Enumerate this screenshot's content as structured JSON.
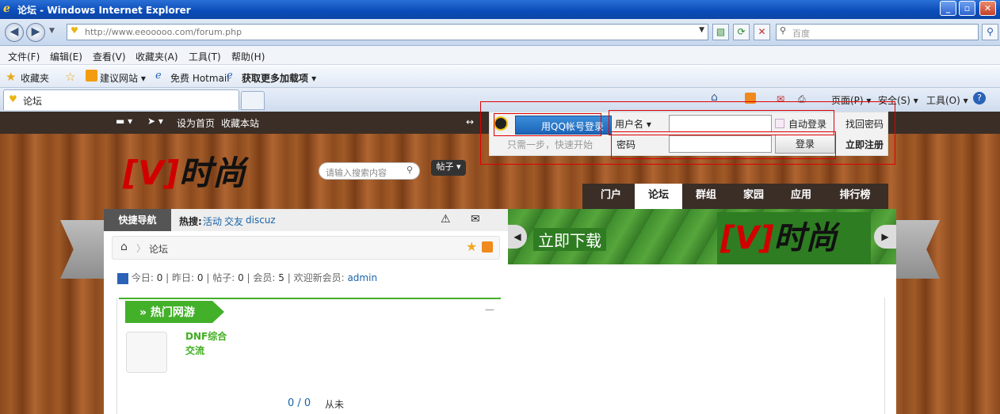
{
  "window": {
    "title": "论坛 - Windows Internet Explorer"
  },
  "address": {
    "url": "http://www.eeooooo.com/forum.php",
    "search_placeholder": "百度"
  },
  "menu": [
    "文件(F)",
    "编辑(E)",
    "查看(V)",
    "收藏夹(A)",
    "工具(T)",
    "帮助(H)"
  ],
  "favorites": {
    "label": "收藏夹",
    "items": [
      "建议网站 ▾",
      "免费 Hotmail",
      "获取更多加载项 ▾"
    ]
  },
  "tab": {
    "label": "论坛"
  },
  "commands": [
    "页面(P) ▾",
    "安全(S) ▾",
    "工具(O) ▾"
  ],
  "topbar": {
    "set_home": "设为首页",
    "bookmark": "收藏本站"
  },
  "login": {
    "qq_button": "用QQ帐号登录",
    "qq_hint": "只需一步，快速开始",
    "username_label": "用户名 ▾",
    "password_label": "密码",
    "auto_login": "自动登录",
    "login_button": "登录",
    "find_password": "找回密码",
    "register": "立即注册"
  },
  "logo": {
    "text": "时尚",
    "v": "[V]"
  },
  "site_search": {
    "placeholder": "请输入搜索内容",
    "type": "帖子 ▾"
  },
  "nav": [
    "门户",
    "论坛",
    "群组",
    "家园",
    "应用",
    "排行榜"
  ],
  "quicknav": "快捷导航",
  "hot": {
    "label": "热搜:",
    "items": [
      "活动",
      "交友",
      "discuz"
    ]
  },
  "breadcrumb": "论坛",
  "banner": {
    "download": "立即下载",
    "logo_v": "[V]",
    "logo_text": "时尚"
  },
  "stats": {
    "today_label": "今日:",
    "today": "0",
    "yesterday_label": "昨日:",
    "yesterday": "0",
    "posts_label": "帖子:",
    "posts": "0",
    "members_label": "会员:",
    "members": "5",
    "welcome_label": "欢迎新会员:",
    "welcome_user": "admin"
  },
  "section": {
    "title": "» 热门网游",
    "forum_name": "DNF综合交流",
    "counts": "0 / 0",
    "last_post": "从未"
  }
}
